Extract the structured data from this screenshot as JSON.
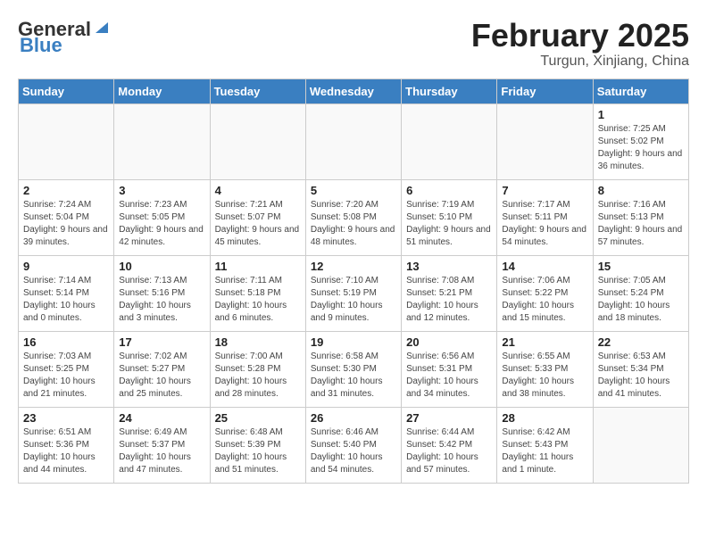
{
  "header": {
    "logo_general": "General",
    "logo_blue": "Blue",
    "month": "February 2025",
    "location": "Turgun, Xinjiang, China"
  },
  "weekdays": [
    "Sunday",
    "Monday",
    "Tuesday",
    "Wednesday",
    "Thursday",
    "Friday",
    "Saturday"
  ],
  "weeks": [
    [
      {
        "day": "",
        "info": ""
      },
      {
        "day": "",
        "info": ""
      },
      {
        "day": "",
        "info": ""
      },
      {
        "day": "",
        "info": ""
      },
      {
        "day": "",
        "info": ""
      },
      {
        "day": "",
        "info": ""
      },
      {
        "day": "1",
        "info": "Sunrise: 7:25 AM\nSunset: 5:02 PM\nDaylight: 9 hours and 36 minutes."
      }
    ],
    [
      {
        "day": "2",
        "info": "Sunrise: 7:24 AM\nSunset: 5:04 PM\nDaylight: 9 hours and 39 minutes."
      },
      {
        "day": "3",
        "info": "Sunrise: 7:23 AM\nSunset: 5:05 PM\nDaylight: 9 hours and 42 minutes."
      },
      {
        "day": "4",
        "info": "Sunrise: 7:21 AM\nSunset: 5:07 PM\nDaylight: 9 hours and 45 minutes."
      },
      {
        "day": "5",
        "info": "Sunrise: 7:20 AM\nSunset: 5:08 PM\nDaylight: 9 hours and 48 minutes."
      },
      {
        "day": "6",
        "info": "Sunrise: 7:19 AM\nSunset: 5:10 PM\nDaylight: 9 hours and 51 minutes."
      },
      {
        "day": "7",
        "info": "Sunrise: 7:17 AM\nSunset: 5:11 PM\nDaylight: 9 hours and 54 minutes."
      },
      {
        "day": "8",
        "info": "Sunrise: 7:16 AM\nSunset: 5:13 PM\nDaylight: 9 hours and 57 minutes."
      }
    ],
    [
      {
        "day": "9",
        "info": "Sunrise: 7:14 AM\nSunset: 5:14 PM\nDaylight: 10 hours and 0 minutes."
      },
      {
        "day": "10",
        "info": "Sunrise: 7:13 AM\nSunset: 5:16 PM\nDaylight: 10 hours and 3 minutes."
      },
      {
        "day": "11",
        "info": "Sunrise: 7:11 AM\nSunset: 5:18 PM\nDaylight: 10 hours and 6 minutes."
      },
      {
        "day": "12",
        "info": "Sunrise: 7:10 AM\nSunset: 5:19 PM\nDaylight: 10 hours and 9 minutes."
      },
      {
        "day": "13",
        "info": "Sunrise: 7:08 AM\nSunset: 5:21 PM\nDaylight: 10 hours and 12 minutes."
      },
      {
        "day": "14",
        "info": "Sunrise: 7:06 AM\nSunset: 5:22 PM\nDaylight: 10 hours and 15 minutes."
      },
      {
        "day": "15",
        "info": "Sunrise: 7:05 AM\nSunset: 5:24 PM\nDaylight: 10 hours and 18 minutes."
      }
    ],
    [
      {
        "day": "16",
        "info": "Sunrise: 7:03 AM\nSunset: 5:25 PM\nDaylight: 10 hours and 21 minutes."
      },
      {
        "day": "17",
        "info": "Sunrise: 7:02 AM\nSunset: 5:27 PM\nDaylight: 10 hours and 25 minutes."
      },
      {
        "day": "18",
        "info": "Sunrise: 7:00 AM\nSunset: 5:28 PM\nDaylight: 10 hours and 28 minutes."
      },
      {
        "day": "19",
        "info": "Sunrise: 6:58 AM\nSunset: 5:30 PM\nDaylight: 10 hours and 31 minutes."
      },
      {
        "day": "20",
        "info": "Sunrise: 6:56 AM\nSunset: 5:31 PM\nDaylight: 10 hours and 34 minutes."
      },
      {
        "day": "21",
        "info": "Sunrise: 6:55 AM\nSunset: 5:33 PM\nDaylight: 10 hours and 38 minutes."
      },
      {
        "day": "22",
        "info": "Sunrise: 6:53 AM\nSunset: 5:34 PM\nDaylight: 10 hours and 41 minutes."
      }
    ],
    [
      {
        "day": "23",
        "info": "Sunrise: 6:51 AM\nSunset: 5:36 PM\nDaylight: 10 hours and 44 minutes."
      },
      {
        "day": "24",
        "info": "Sunrise: 6:49 AM\nSunset: 5:37 PM\nDaylight: 10 hours and 47 minutes."
      },
      {
        "day": "25",
        "info": "Sunrise: 6:48 AM\nSunset: 5:39 PM\nDaylight: 10 hours and 51 minutes."
      },
      {
        "day": "26",
        "info": "Sunrise: 6:46 AM\nSunset: 5:40 PM\nDaylight: 10 hours and 54 minutes."
      },
      {
        "day": "27",
        "info": "Sunrise: 6:44 AM\nSunset: 5:42 PM\nDaylight: 10 hours and 57 minutes."
      },
      {
        "day": "28",
        "info": "Sunrise: 6:42 AM\nSunset: 5:43 PM\nDaylight: 11 hours and 1 minute."
      },
      {
        "day": "",
        "info": ""
      }
    ]
  ]
}
